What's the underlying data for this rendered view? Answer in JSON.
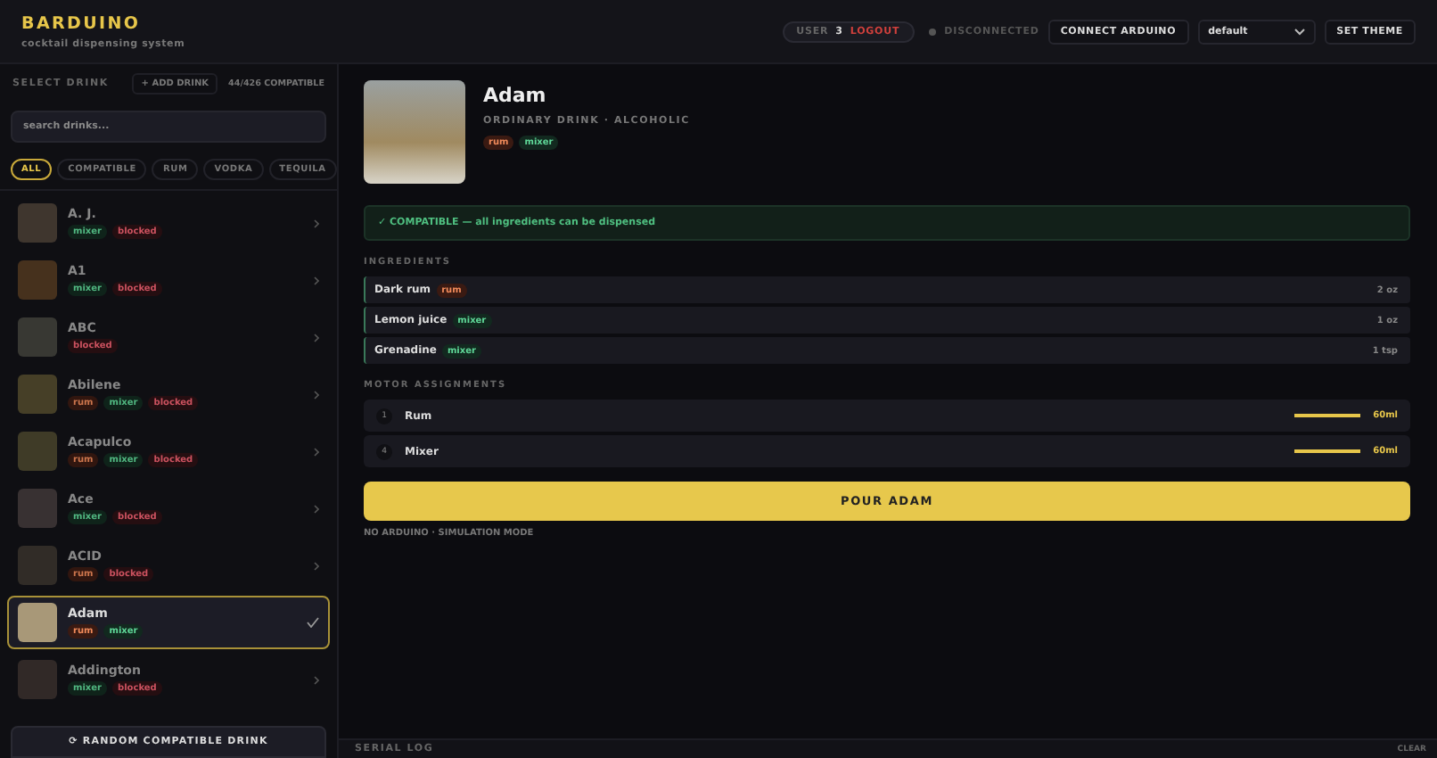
{
  "header": {
    "title": "BARDUINO",
    "subtitle": "cocktail dispensing system",
    "user_label": "USER",
    "user_id": "3",
    "logout": "LOGOUT",
    "connection": {
      "label": "DISCONNECTED",
      "connected": false
    },
    "connect_button": "CONNECT ARDUINO",
    "theme_select": "default",
    "set_theme_button": "SET THEME"
  },
  "sidebar": {
    "title": "SELECT DRINK",
    "add_button": "+ ADD DRINK",
    "count": "44/426 COMPATIBLE",
    "search": {
      "placeholder": "search drinks..."
    },
    "filters": [
      {
        "label": "ALL",
        "selected": true
      },
      {
        "label": "COMPATIBLE",
        "selected": false
      },
      {
        "label": "RUM",
        "selected": false
      },
      {
        "label": "VODKA",
        "selected": false
      },
      {
        "label": "TEQUILA",
        "selected": false
      }
    ],
    "drinks": [
      {
        "name": "A. J.",
        "compatible": false,
        "selected": false,
        "tags": [
          {
            "label": "mixer",
            "kind": "mixer"
          },
          {
            "label": "blocked",
            "kind": "blocked"
          }
        ]
      },
      {
        "name": "A1",
        "compatible": false,
        "selected": false,
        "tags": [
          {
            "label": "mixer",
            "kind": "mixer"
          },
          {
            "label": "blocked",
            "kind": "blocked"
          }
        ]
      },
      {
        "name": "ABC",
        "compatible": false,
        "selected": false,
        "tags": [
          {
            "label": "blocked",
            "kind": "blocked"
          }
        ]
      },
      {
        "name": "Abilene",
        "compatible": false,
        "selected": false,
        "tags": [
          {
            "label": "rum",
            "kind": "rum"
          },
          {
            "label": "mixer",
            "kind": "mixer"
          },
          {
            "label": "blocked",
            "kind": "blocked"
          }
        ]
      },
      {
        "name": "Acapulco",
        "compatible": false,
        "selected": false,
        "tags": [
          {
            "label": "rum",
            "kind": "rum"
          },
          {
            "label": "mixer",
            "kind": "mixer"
          },
          {
            "label": "blocked",
            "kind": "blocked"
          }
        ]
      },
      {
        "name": "Ace",
        "compatible": false,
        "selected": false,
        "tags": [
          {
            "label": "mixer",
            "kind": "mixer"
          },
          {
            "label": "blocked",
            "kind": "blocked"
          }
        ]
      },
      {
        "name": "ACID",
        "compatible": false,
        "selected": false,
        "tags": [
          {
            "label": "rum",
            "kind": "rum"
          },
          {
            "label": "blocked",
            "kind": "blocked"
          }
        ]
      },
      {
        "name": "Adam",
        "compatible": true,
        "selected": true,
        "tags": [
          {
            "label": "rum",
            "kind": "rum"
          },
          {
            "label": "mixer",
            "kind": "mixer"
          }
        ]
      },
      {
        "name": "Addington",
        "compatible": false,
        "selected": false,
        "tags": [
          {
            "label": "mixer",
            "kind": "mixer"
          },
          {
            "label": "blocked",
            "kind": "blocked"
          }
        ]
      }
    ],
    "random_button": "⟳ RANDOM COMPATIBLE DRINK"
  },
  "detail": {
    "name": "Adam",
    "category": "ORDINARY DRINK · ALCOHOLIC",
    "tags": [
      {
        "label": "rum",
        "kind": "rum"
      },
      {
        "label": "mixer",
        "kind": "mixer"
      }
    ],
    "status": {
      "compatible": true,
      "text": "✓ COMPATIBLE — all ingredients can be dispensed"
    },
    "ingredients_title": "INGREDIENTS",
    "ingredients": [
      {
        "name": "Dark rum",
        "tag": {
          "label": "rum",
          "kind": "rum"
        },
        "amount": "2 oz"
      },
      {
        "name": "Lemon juice",
        "tag": {
          "label": "mixer",
          "kind": "mixer"
        },
        "amount": "1 oz"
      },
      {
        "name": "Grenadine",
        "tag": {
          "label": "mixer",
          "kind": "mixer"
        },
        "amount": "1 tsp"
      }
    ],
    "motors_title": "MOTOR ASSIGNMENTS",
    "motors": [
      {
        "number": "1",
        "name": "Rum",
        "level": 1,
        "amount": "60ml"
      },
      {
        "number": "4",
        "name": "Mixer",
        "level": 1,
        "amount": "60ml"
      }
    ],
    "pour_button": "POUR ADAM",
    "mode_note": "NO ARDUINO · SIMULATION MODE"
  },
  "serial_log": {
    "title": "SERIAL LOG",
    "clear_button": "CLEAR"
  }
}
